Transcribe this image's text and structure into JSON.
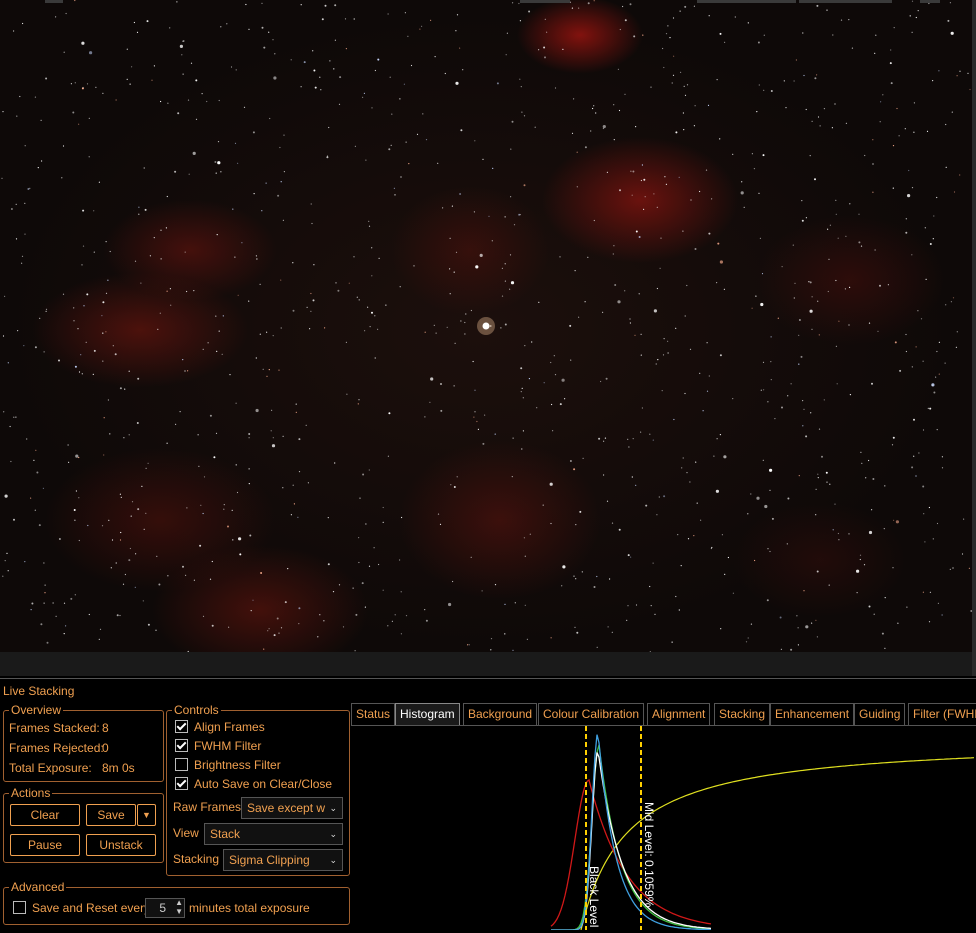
{
  "panel": {
    "title": "Live Stacking"
  },
  "overview": {
    "label": "Overview",
    "frames_stacked_label": "Frames Stacked:",
    "frames_stacked_value": "8",
    "frames_rejected_label": "Frames Rejected:",
    "frames_rejected_value": "0",
    "total_exposure_label": "Total Exposure:",
    "total_exposure_value": "8m 0s"
  },
  "actions": {
    "label": "Actions",
    "clear": "Clear",
    "save": "Save",
    "pause": "Pause",
    "unstack": "Unstack"
  },
  "controls": {
    "label": "Controls",
    "align_frames": "Align Frames",
    "align_frames_checked": true,
    "fwhm_filter": "FWHM Filter",
    "fwhm_filter_checked": true,
    "brightness_filter": "Brightness Filter",
    "brightness_filter_checked": false,
    "auto_save": "Auto Save on Clear/Close",
    "auto_save_checked": true,
    "raw_frames_label": "Raw Frames",
    "raw_frames_value": "Save except w",
    "view_label": "View",
    "view_value": "Stack",
    "stacking_label": "Stacking",
    "stacking_value": "Sigma Clipping"
  },
  "advanced": {
    "label": "Advanced",
    "save_reset_label": "Save and Reset every",
    "save_reset_checked": false,
    "minutes_value": "5",
    "minutes_suffix": "minutes total exposure"
  },
  "tabs": [
    {
      "label": "Status"
    },
    {
      "label": "Histogram",
      "active": true
    },
    {
      "label": "Background"
    },
    {
      "label": "Colour Calibration"
    },
    {
      "label": "Alignment"
    },
    {
      "label": "Stacking"
    },
    {
      "label": "Enhancement"
    },
    {
      "label": "Guiding"
    },
    {
      "label": "Filter (FWHM"
    }
  ],
  "histogram": {
    "black_level_label": "Black Level",
    "mid_level_label": "Mid Level: 0.1059%",
    "colors": {
      "red": "#d01818",
      "green": "#40c040",
      "blue": "#40a0e0",
      "luminance": "#ffffff",
      "stretch_curve": "#e0e020",
      "marker": "#ffd000"
    }
  },
  "colors": {
    "accent": "#f0a050",
    "background": "#000000"
  }
}
